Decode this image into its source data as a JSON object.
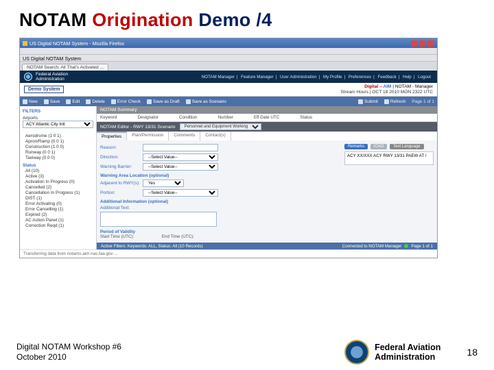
{
  "slide": {
    "title_p1": "NOTAM ",
    "title_p2": "Origination ",
    "title_p3": "Demo /4",
    "workshop_l1": "Digital NOTAM Workshop #6",
    "workshop_l2": "October 2010",
    "faa_l1": "Federal Aviation",
    "faa_l2": "Administration",
    "page_num": "18"
  },
  "win": {
    "title": "US Digital NOTAM System - Mozilla Firefox",
    "tab": "NOTAM Search: All That's Activated ...",
    "url_label": "US Digital NOTAM System"
  },
  "topstrip": {
    "agency_l1": "Federal Aviation",
    "agency_l2": "Administration",
    "links": [
      "NOTAM Manager",
      "Feature Manager",
      "User Administration",
      "My Profile",
      "Preferences",
      "Feedback",
      "Help",
      "Logout"
    ]
  },
  "brand": {
    "demo": "Demo System",
    "d1": "Digital – ",
    "d2": "AIM",
    "d3": " | NOTAM - Manager",
    "stream": "Stream Hours | OCT 18 2010 MON 2322 UTC"
  },
  "toolbar": {
    "items": [
      "New",
      "Save",
      "Edit",
      "Delete",
      "Error Check",
      "Save as Draft",
      "Save as Scenario"
    ],
    "submit": "Submit",
    "refresh": "Refresh",
    "page": "Page 1 of 1"
  },
  "sidebar": {
    "filters": "FILTERS",
    "airports": "Airports",
    "airport_sel": "ACY Atlantic City Intl",
    "list": [
      "Aerodrome (1 0 1)",
      "Apron/Ramp (0 0 1)",
      "Construction (1 0 0)",
      "Runway (0 0 1)",
      "Taxiway (0 0 0)"
    ],
    "status_h": "Status",
    "status": [
      "All (10)",
      "Active (3)",
      "Activation In Progress (0)",
      "Cancelled (2)",
      "Cancellation In Progress (1)",
      "DIST (1)",
      "Error Activating (0)",
      "Error Cancelling (1)",
      "Expired (2)",
      "AC Action Panel (1)",
      "Correction Reqd (1)"
    ]
  },
  "summary": {
    "header": "NOTAM Summary",
    "cols": [
      "Keyword",
      "Designator",
      "Condition",
      "Number",
      "Eff Date UTC",
      "Status"
    ]
  },
  "editor": {
    "header": "NOTAM Editor - RWY 13/31 Scenario",
    "scenario_sel": "Personnel and Equipment Working",
    "tabs": [
      "Properties",
      "Plan/Permission",
      "Comments",
      "Contact(s)"
    ],
    "reason_lbl": "Reason:",
    "direction_lbl": "Direction:",
    "direction_sel": "--Select Value--",
    "warning_lbl": "Warning Barrier:",
    "warning_sel": "--Select Value--",
    "warn_loc": "Warning Area Location (optional)",
    "adjrwy_lbl": "Adjacent to RWY(s):",
    "adjrwy_sel": "Yes",
    "portion_lbl": "Portion:",
    "portion_sel": "--Select Value--",
    "addinfo": "Additional Information (optional)",
    "addtext": "Additional Text:",
    "period": "Period of Validity",
    "start": "Start Time (UTC):",
    "end": "End Time (UTC):",
    "pill_rem": "Remarks",
    "pill_icao": "ICAO",
    "pill_lang": "Text Language",
    "preview": "ACY XX/XXX ACY RWY 13/31 PAEW AT /"
  },
  "bottom": {
    "filters": "Active Filters: Keywords: ALL, Status: All (10 Records)",
    "conn": "Connected to NOTAM Manager",
    "pg": "Page 1 of 1",
    "status": "Transferring data from notams.aim.nas.faa.gov ..."
  }
}
